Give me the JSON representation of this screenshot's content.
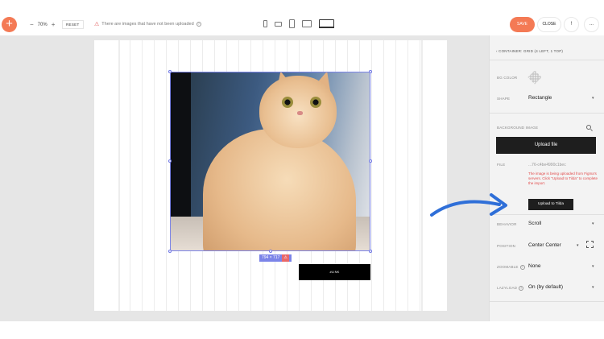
{
  "toolbar": {
    "add_label": "+",
    "zoom_minus": "−",
    "zoom_value": "70%",
    "zoom_plus": "+",
    "reset_label": "RESET",
    "warning_text": "There are images that have not been uploaded",
    "help_label": "?",
    "save_label": "SAVE",
    "close_label": "CLOSE",
    "info_label": "!",
    "more_label": "...",
    "accent_color": "#f47a55"
  },
  "canvas": {
    "image_size_label": "794 × 717",
    "button_label": "#LINK"
  },
  "panel": {
    "breadcrumb": "‹ CONTAINER: GRID (4 LEFT, 1 TOP)",
    "bg_color_label": "BG COLOR",
    "shape_label": "SHAPE",
    "shape_value": "Rectangle",
    "background_image_label": "BACKGROUND IMAGE",
    "upload_file_label": "Upload file",
    "file_label": "FILE",
    "file_value": "...76-c4be4990c1bec",
    "error_text": "The image is being uploaded from Figma's servers. Click \"Upload to Tilda\" to complete the import.",
    "upload_tilda_label": "Upload to Tilda",
    "behavior_label": "BEHAVIOR",
    "behavior_value": "Scroll",
    "position_label": "POSITION",
    "position_value": "Center Center",
    "zoomable_label": "ZOOMABLE",
    "zoomable_value": "None",
    "lazyload_label": "LAZYLOAD",
    "lazyload_value": "On (by default)",
    "help_label": "?",
    "chevron": "▾"
  }
}
